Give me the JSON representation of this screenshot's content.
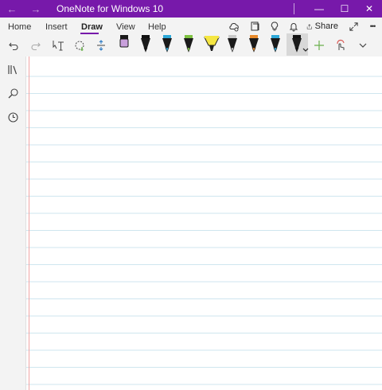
{
  "window": {
    "title": "OneNote for Windows 10",
    "back_icon": "←",
    "forward_icon": "→",
    "minimize_icon": "—",
    "maximize_icon": "☐",
    "close_icon": "✕",
    "accent_color": "#7719aa"
  },
  "menu": {
    "tabs": [
      {
        "label": "Home"
      },
      {
        "label": "Insert"
      },
      {
        "label": "Draw",
        "active": true
      },
      {
        "label": "View"
      },
      {
        "label": "Help"
      }
    ],
    "share_label": "Share",
    "more_icon": "•••"
  },
  "toolbar": {
    "pens": [
      {
        "icon": "pen-icon",
        "color": "#c9a0dc"
      },
      {
        "icon": "pen-icon",
        "color": "#111111"
      },
      {
        "icon": "pen-icon",
        "color": "#2ea8d8"
      },
      {
        "icon": "pen-icon",
        "color": "#7ec242"
      },
      {
        "icon": "highlighter-icon",
        "color": "#f5e642"
      },
      {
        "icon": "pen-icon",
        "color": "#c8c8c8"
      },
      {
        "icon": "pen-icon",
        "color": "#e88a2a"
      },
      {
        "icon": "pen-icon",
        "color": "#2ea8d8"
      },
      {
        "icon": "pen-icon",
        "color": "#111111",
        "selected": true
      }
    ]
  },
  "page": {
    "margin_color": "#f0a4a4",
    "rule_color": "#cfe6ef"
  }
}
